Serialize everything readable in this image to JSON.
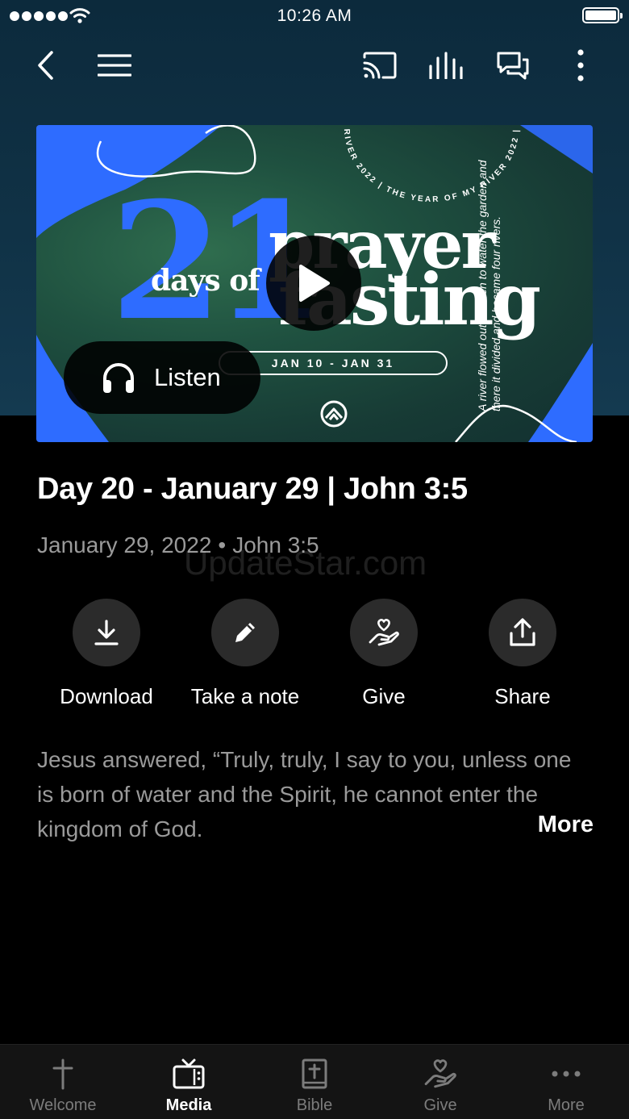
{
  "status_bar": {
    "time": "10:26 AM"
  },
  "hero": {
    "number": "21",
    "days_of": "days of",
    "prayer": "prayer",
    "fasting": "fasting",
    "date_range": "JAN 10 - JAN 31",
    "arc_text": "RIVER 2022 | THE YEAR OF MY RIVER 2022 |",
    "verse": "A river flowed out of Eden to water the garden and there it divided and became four rivers.",
    "listen_label": "Listen"
  },
  "media": {
    "title": "Day 20 - January 29 | John 3:5",
    "date": "January 29, 2022",
    "separator": "•",
    "reference": "John 3:5",
    "watermark": "UpdateStar.com",
    "description": "Jesus answered, “Truly, truly, I say to you, unless one is born of water and the Spirit, he cannot enter the kingdom of God.",
    "more_label": "More"
  },
  "actions": [
    {
      "label": "Download",
      "icon": "download-icon"
    },
    {
      "label": "Take a note",
      "icon": "pencil-icon"
    },
    {
      "label": "Give",
      "icon": "give-heart-hand-icon"
    },
    {
      "label": "Share",
      "icon": "share-icon"
    }
  ],
  "tabs": [
    {
      "label": "Welcome",
      "icon": "cross-icon",
      "active": false
    },
    {
      "label": "Media",
      "icon": "tv-icon",
      "active": true
    },
    {
      "label": "Bible",
      "icon": "bible-icon",
      "active": false
    },
    {
      "label": "Give",
      "icon": "give-heart-hand-icon",
      "active": false
    },
    {
      "label": "More",
      "icon": "more-dots-icon",
      "active": false
    }
  ],
  "colors": {
    "brand_blue": "#2e6cff",
    "background": "#000000",
    "muted_text": "#9a9a9a",
    "tab_bar": "#141414"
  }
}
